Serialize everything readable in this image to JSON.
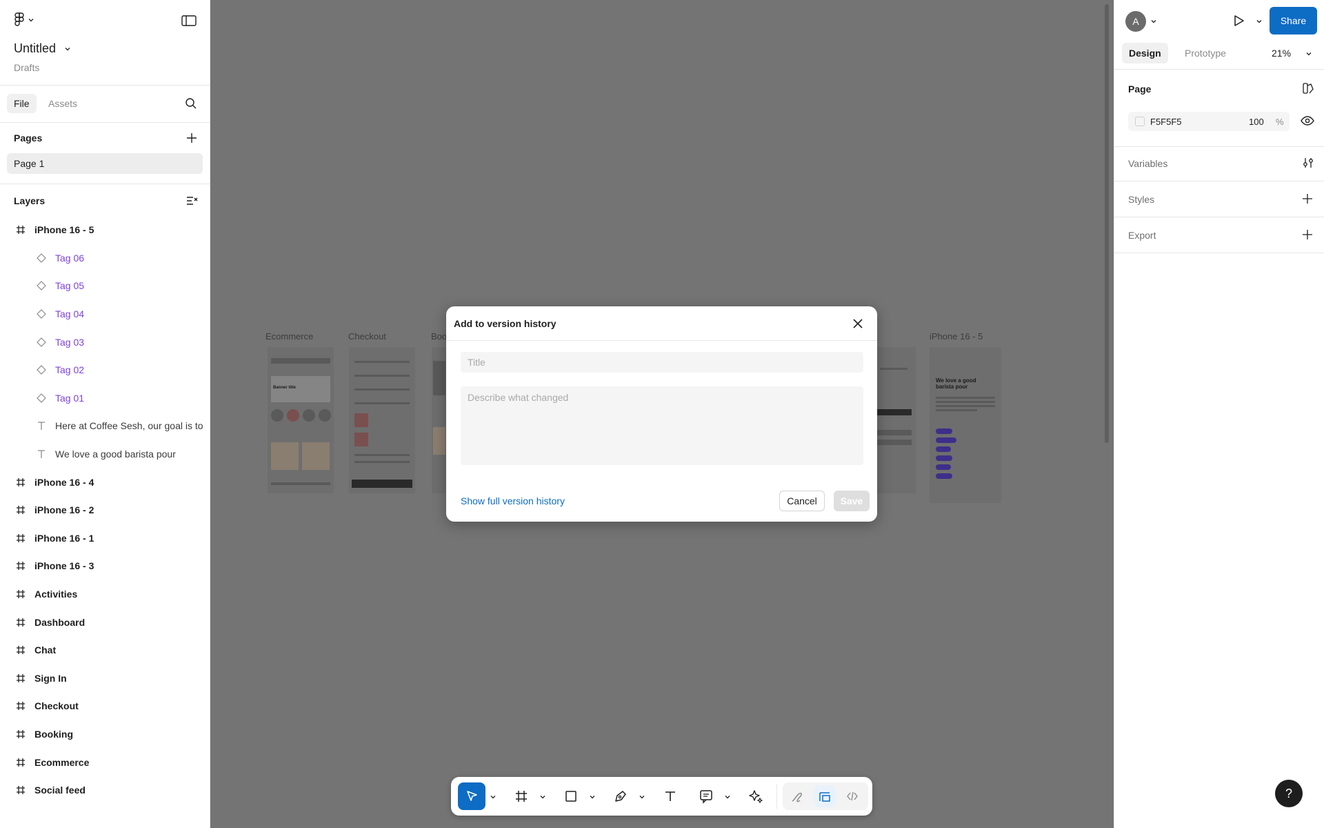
{
  "file": {
    "title": "Untitled",
    "location": "Drafts"
  },
  "left_tabs": {
    "file": "File",
    "assets": "Assets"
  },
  "pages": {
    "label": "Pages",
    "items": [
      "Page 1"
    ]
  },
  "layers": {
    "label": "Layers",
    "items": [
      {
        "name": "iPhone 16 - 5",
        "kind": "frame"
      },
      {
        "name": "Tag 06",
        "kind": "component"
      },
      {
        "name": "Tag 05",
        "kind": "component"
      },
      {
        "name": "Tag 04",
        "kind": "component"
      },
      {
        "name": "Tag 03",
        "kind": "component"
      },
      {
        "name": "Tag 02",
        "kind": "component"
      },
      {
        "name": "Tag 01",
        "kind": "component"
      },
      {
        "name": "Here at Coffee Sesh, our goal is to",
        "kind": "text"
      },
      {
        "name": "We love a good barista pour",
        "kind": "text"
      },
      {
        "name": "iPhone 16 - 4",
        "kind": "frame"
      },
      {
        "name": "iPhone 16 - 2",
        "kind": "frame"
      },
      {
        "name": "iPhone 16 - 1",
        "kind": "frame"
      },
      {
        "name": "iPhone 16 - 3",
        "kind": "frame"
      },
      {
        "name": "Activities",
        "kind": "frame"
      },
      {
        "name": "Dashboard",
        "kind": "frame"
      },
      {
        "name": "Chat",
        "kind": "frame"
      },
      {
        "name": "Sign In",
        "kind": "frame"
      },
      {
        "name": "Checkout",
        "kind": "frame"
      },
      {
        "name": "Booking",
        "kind": "frame"
      },
      {
        "name": "Ecommerce",
        "kind": "frame"
      },
      {
        "name": "Social feed",
        "kind": "frame"
      }
    ]
  },
  "canvas": {
    "frame_labels": {
      "ecommerce": "Ecommerce",
      "checkout": "Checkout",
      "booking": "Boo",
      "iphone5": "iPhone 16 - 5"
    },
    "thumb_text": {
      "banner": "Banner title",
      "barista": "We love a good barista pour"
    }
  },
  "right": {
    "avatar_initial": "A",
    "share_label": "Share",
    "tabs": {
      "design": "Design",
      "prototype": "Prototype"
    },
    "zoom": "21%",
    "page_section": "Page",
    "page_color": "F5F5F5",
    "page_opacity": "100",
    "page_opacity_unit": "%",
    "variables": "Variables",
    "styles": "Styles",
    "export": "Export"
  },
  "modal": {
    "title": "Add to version history",
    "title_placeholder": "Title",
    "desc_placeholder": "Describe what changed",
    "show_history": "Show full version history",
    "cancel": "Cancel",
    "save": "Save"
  },
  "help": "?",
  "colors": {
    "accent": "#0d6cc4",
    "component": "#7b43e0",
    "canvas": "#747474"
  }
}
